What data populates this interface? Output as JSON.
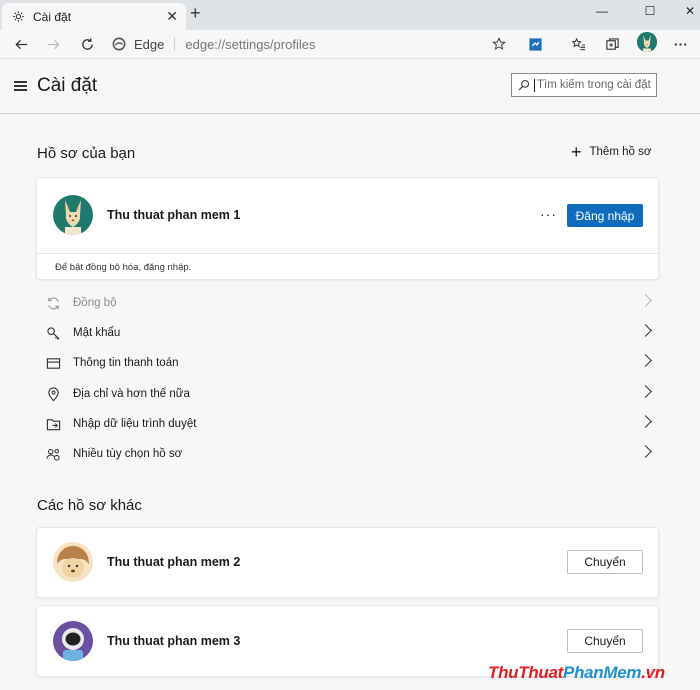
{
  "tab": {
    "title": "Cài đặt",
    "close_glyph": "✕"
  },
  "new_tab_glyph": "+",
  "window_controls": [
    "—",
    "☐",
    "✕"
  ],
  "address": {
    "brand": "Edge",
    "url": "edge://settings/profiles"
  },
  "header": {
    "title": "Cài đặt",
    "search_placeholder": "Tìm kiếm trong cài đặt"
  },
  "profiles_section": {
    "title": "Hồ sơ của bạn",
    "add_label": "Thêm hồ sơ"
  },
  "current_profile": {
    "name": "Thu thuat phan mem 1",
    "more_glyph": "···",
    "signin_label": "Đăng nhập",
    "note": "Để bật đồng bộ hóa, đăng nhập."
  },
  "menu": [
    {
      "label": "Đồng bộ",
      "icon": "sync-icon",
      "disabled": true
    },
    {
      "label": "Mật khẩu",
      "icon": "key-icon",
      "disabled": false
    },
    {
      "label": "Thông tin thanh toán",
      "icon": "card-icon",
      "disabled": false
    },
    {
      "label": "Địa chỉ và hơn thế nữa",
      "icon": "location-icon",
      "disabled": false
    },
    {
      "label": "Nhập dữ liệu trình duyệt",
      "icon": "import-icon",
      "disabled": false
    },
    {
      "label": "Nhiều tùy chọn hồ sơ",
      "icon": "people-settings-icon",
      "disabled": false
    }
  ],
  "other_section": {
    "title": "Các hồ sơ khác"
  },
  "other_profiles": [
    {
      "name": "Thu thuat phan mem 2",
      "switch_label": "Chuyển"
    },
    {
      "name": "Thu thuat phan mem 3",
      "switch_label": "Chuyển"
    }
  ],
  "watermark": {
    "part1": "ThuThuat",
    "part2": "PhanMem",
    "part3": ".vn"
  },
  "colors": {
    "accent": "#0f6cbd",
    "watermark_red": "#e02020",
    "watermark_blue": "#1e8fd6"
  }
}
